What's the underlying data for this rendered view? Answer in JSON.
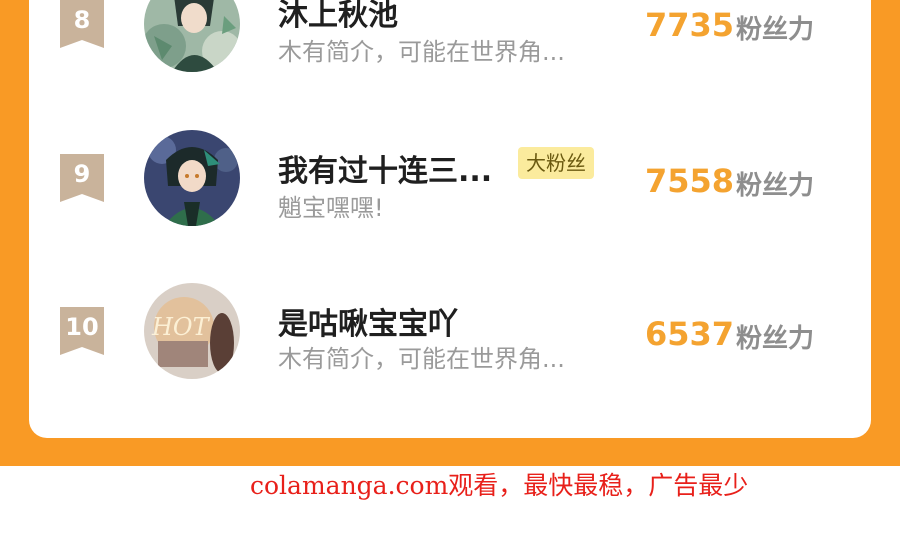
{
  "leaderboard": {
    "score_unit": "粉丝力",
    "rows": [
      {
        "rank": "8",
        "name": "沐上秋池",
        "bio": "木有简介，可能在世界角...",
        "score": "7735",
        "avatar": "avatar-green-hair-plants"
      },
      {
        "rank": "9",
        "name": "我有过十连三...",
        "badge": "大粉丝",
        "bio": "魈宝嘿嘿!",
        "score": "7558",
        "avatar": "avatar-xiao-character"
      },
      {
        "rank": "10",
        "name": "是咕啾宝宝吖",
        "bio": "木有简介，可能在世界角...",
        "score": "6537",
        "avatar": "avatar-hot-neon-sign"
      }
    ]
  },
  "watermark": "colamanga.com观看，最快最稳，广告最少",
  "colors": {
    "frame": "#f99a25",
    "score": "#f4a330",
    "badge_bg": "#fbeb9d",
    "rank_badge": "#c9b39b",
    "watermark": "#e8201a"
  }
}
